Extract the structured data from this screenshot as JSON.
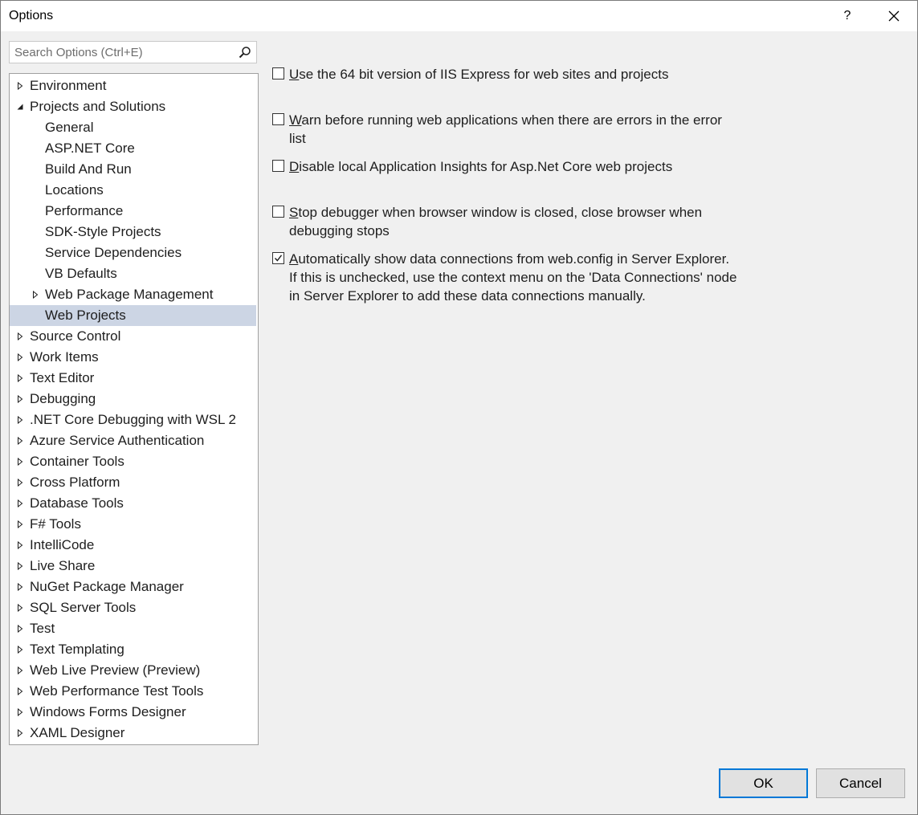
{
  "window": {
    "title": "Options",
    "help_label": "?",
    "close_label": "✕"
  },
  "search": {
    "placeholder": "Search Options (Ctrl+E)"
  },
  "tree": {
    "items": [
      {
        "label": "Environment",
        "level": 0,
        "expander": "collapsed"
      },
      {
        "label": "Projects and Solutions",
        "level": 0,
        "expander": "expanded"
      },
      {
        "label": "General",
        "level": 1,
        "expander": "none"
      },
      {
        "label": "ASP.NET Core",
        "level": 1,
        "expander": "none"
      },
      {
        "label": "Build And Run",
        "level": 1,
        "expander": "none"
      },
      {
        "label": "Locations",
        "level": 1,
        "expander": "none"
      },
      {
        "label": "Performance",
        "level": 1,
        "expander": "none"
      },
      {
        "label": "SDK-Style Projects",
        "level": 1,
        "expander": "none"
      },
      {
        "label": "Service Dependencies",
        "level": 1,
        "expander": "none"
      },
      {
        "label": "VB Defaults",
        "level": 1,
        "expander": "none"
      },
      {
        "label": "Web Package Management",
        "level": 1,
        "expander": "collapsed"
      },
      {
        "label": "Web Projects",
        "level": 1,
        "expander": "none",
        "selected": true
      },
      {
        "label": "Source Control",
        "level": 0,
        "expander": "collapsed"
      },
      {
        "label": "Work Items",
        "level": 0,
        "expander": "collapsed"
      },
      {
        "label": "Text Editor",
        "level": 0,
        "expander": "collapsed"
      },
      {
        "label": "Debugging",
        "level": 0,
        "expander": "collapsed"
      },
      {
        "label": ".NET Core Debugging with WSL 2",
        "level": 0,
        "expander": "collapsed"
      },
      {
        "label": "Azure Service Authentication",
        "level": 0,
        "expander": "collapsed"
      },
      {
        "label": "Container Tools",
        "level": 0,
        "expander": "collapsed"
      },
      {
        "label": "Cross Platform",
        "level": 0,
        "expander": "collapsed"
      },
      {
        "label": "Database Tools",
        "level": 0,
        "expander": "collapsed"
      },
      {
        "label": "F# Tools",
        "level": 0,
        "expander": "collapsed"
      },
      {
        "label": "IntelliCode",
        "level": 0,
        "expander": "collapsed"
      },
      {
        "label": "Live Share",
        "level": 0,
        "expander": "collapsed"
      },
      {
        "label": "NuGet Package Manager",
        "level": 0,
        "expander": "collapsed"
      },
      {
        "label": "SQL Server Tools",
        "level": 0,
        "expander": "collapsed"
      },
      {
        "label": "Test",
        "level": 0,
        "expander": "collapsed"
      },
      {
        "label": "Text Templating",
        "level": 0,
        "expander": "collapsed"
      },
      {
        "label": "Web Live Preview (Preview)",
        "level": 0,
        "expander": "collapsed"
      },
      {
        "label": "Web Performance Test Tools",
        "level": 0,
        "expander": "collapsed"
      },
      {
        "label": "Windows Forms Designer",
        "level": 0,
        "expander": "collapsed"
      },
      {
        "label": "XAML Designer",
        "level": 0,
        "expander": "collapsed"
      }
    ]
  },
  "options": [
    {
      "key": "iis64",
      "accel": "U",
      "rest": "se the 64 bit version of IIS Express for web sites and projects",
      "checked": false
    },
    {
      "key": "warn",
      "accel": "W",
      "rest": "arn before running web applications when there are errors in the error list",
      "checked": false
    },
    {
      "key": "insights",
      "accel": "D",
      "rest": "isable local Application Insights for Asp.Net Core web projects",
      "checked": false
    },
    {
      "key": "stopdbg",
      "accel": "S",
      "rest": "top debugger when browser window is closed, close browser when debugging stops",
      "checked": false
    },
    {
      "key": "dataconn",
      "accel": "A",
      "rest": "utomatically show data connections from web.config in Server Explorer. If this is unchecked, use the context menu on the 'Data Connections' node in Server Explorer to add these data connections manually.",
      "checked": true
    }
  ],
  "buttons": {
    "ok": "OK",
    "cancel": "Cancel"
  }
}
